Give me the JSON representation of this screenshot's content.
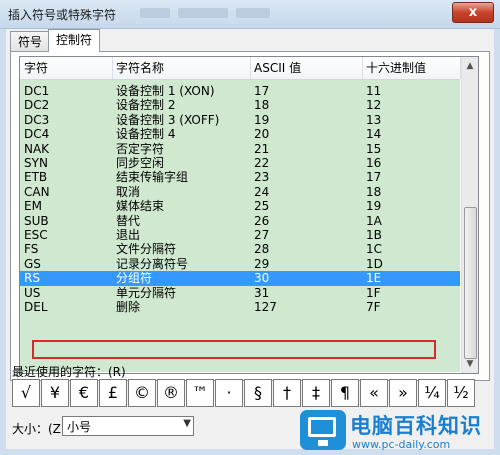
{
  "window": {
    "title": "插入符号或特殊字符",
    "close_label": "x"
  },
  "tabs": [
    {
      "label": "符号"
    },
    {
      "label": "控制符"
    }
  ],
  "list": {
    "columns": [
      "字符",
      "字符名称",
      "ASCII 值",
      "十六进制值"
    ],
    "rows": [
      {
        "char": "DC1",
        "name": "设备控制 1 (XON)",
        "ascii": "17",
        "hex": "11"
      },
      {
        "char": "DC2",
        "name": "设备控制 2",
        "ascii": "18",
        "hex": "12"
      },
      {
        "char": "DC3",
        "name": "设备控制 3 (XOFF)",
        "ascii": "19",
        "hex": "13"
      },
      {
        "char": "DC4",
        "name": "设备控制 4",
        "ascii": "20",
        "hex": "14"
      },
      {
        "char": "NAK",
        "name": "否定字符",
        "ascii": "21",
        "hex": "15"
      },
      {
        "char": "SYN",
        "name": "同步空闲",
        "ascii": "22",
        "hex": "16"
      },
      {
        "char": "ETB",
        "name": "结束传输字组",
        "ascii": "23",
        "hex": "17"
      },
      {
        "char": "CAN",
        "name": "取消",
        "ascii": "24",
        "hex": "18"
      },
      {
        "char": "EM",
        "name": "媒体结束",
        "ascii": "25",
        "hex": "19"
      },
      {
        "char": "SUB",
        "name": "替代",
        "ascii": "26",
        "hex": "1A"
      },
      {
        "char": "ESC",
        "name": "退出",
        "ascii": "27",
        "hex": "1B"
      },
      {
        "char": "FS",
        "name": "文件分隔符",
        "ascii": "28",
        "hex": "1C"
      },
      {
        "char": "GS",
        "name": "记录分离符号",
        "ascii": "29",
        "hex": "1D"
      },
      {
        "char": "RS",
        "name": "分组符",
        "ascii": "30",
        "hex": "1E"
      },
      {
        "char": "US",
        "name": "单元分隔符",
        "ascii": "31",
        "hex": "1F"
      },
      {
        "char": "DEL",
        "name": "删除",
        "ascii": "127",
        "hex": "7F"
      }
    ],
    "selected_index": 13
  },
  "recent": {
    "label": "最近使用的字符：(R)",
    "symbols": [
      "√",
      "¥",
      "€",
      "£",
      "©",
      "®",
      "™",
      "·",
      "§",
      "†",
      "‡",
      "¶",
      "«",
      "»",
      "¼",
      "½"
    ]
  },
  "size": {
    "label": "大小：(Z)",
    "value": "小号"
  },
  "watermark": {
    "name": "电脑百科知识",
    "url": "www.pc-daily.com"
  },
  "colors": {
    "selection": "#3399ff",
    "row_bg": "#cfe8cf",
    "highlight_box": "#d62b2b",
    "brand": "#1a7fd0"
  }
}
